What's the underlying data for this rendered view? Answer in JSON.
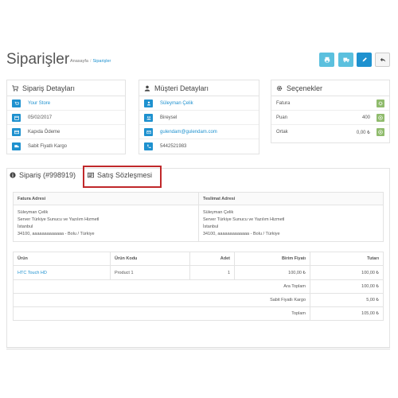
{
  "header": {
    "title": "Siparişler",
    "breadcrumb": [
      "Anasayfa",
      "Siparişler"
    ]
  },
  "order_details": {
    "title": "Sipariş Detayları",
    "rows": [
      {
        "icon": "cart-icon",
        "text": "Your Store"
      },
      {
        "icon": "calendar-icon",
        "text": "05/02/2017"
      },
      {
        "icon": "credit-card-icon",
        "text": "Kapıda Ödeme"
      },
      {
        "icon": "truck-icon",
        "text": "Sabit Fiyatlı Kargo"
      }
    ]
  },
  "customer_details": {
    "title": "Müşteri Detayları",
    "rows": [
      {
        "icon": "user-icon",
        "text": "Süleyman Çelik"
      },
      {
        "icon": "group-icon",
        "text": "Bireysel"
      },
      {
        "icon": "envelope-icon",
        "text": "gulendam@gulendam.com"
      },
      {
        "icon": "phone-icon",
        "text": "5442521983"
      }
    ]
  },
  "options": {
    "title": "Seçenekler",
    "rows": [
      {
        "label": "Fatura",
        "value": ""
      },
      {
        "label": "Puan",
        "value": "400"
      },
      {
        "label": "Ortak",
        "value": "0,00 ₺"
      }
    ]
  },
  "tabs": {
    "order": "Sipariş (#998919)",
    "contract": "Satış Sözleşmesi"
  },
  "address_table": {
    "headers": [
      "Fatura Adresi",
      "Teslimat Adresi"
    ],
    "billing": [
      "Süleyman Çelik",
      "Server Türkiye Sunucu ve Yazılım Hizmetl",
      "İstanbul",
      "34100, aaaaaaaaaaaaa - Bolu / Türkiye"
    ],
    "shipping": [
      "Süleyman Çelik",
      "Server Türkiye Sunucu ve Yazılım Hizmetl",
      "İstanbul",
      "34100, aaaaaaaaaaaaa - Bolu / Türkiye"
    ]
  },
  "products_table": {
    "headers": [
      "Ürün",
      "Ürün Kodu",
      "Adet",
      "Birim Fiyatı",
      "Tutarı"
    ],
    "rows": [
      {
        "product": "HTC Touch HD",
        "code": "Product 1",
        "qty": "1",
        "unit_price": "100,00 ₺",
        "total": "100,00 ₺"
      }
    ],
    "totals": [
      {
        "label": "Ara Toplam",
        "value": "100,00 ₺"
      },
      {
        "label": "Sabit Fiyatlı Kargo",
        "value": "5,00 ₺"
      },
      {
        "label": "Toplam",
        "value": "105,00 ₺"
      }
    ]
  },
  "colors": {
    "primary": "#1e91cf",
    "info": "#5bc0de",
    "success": "#8fbb6c",
    "highlight": "#c0282a"
  }
}
